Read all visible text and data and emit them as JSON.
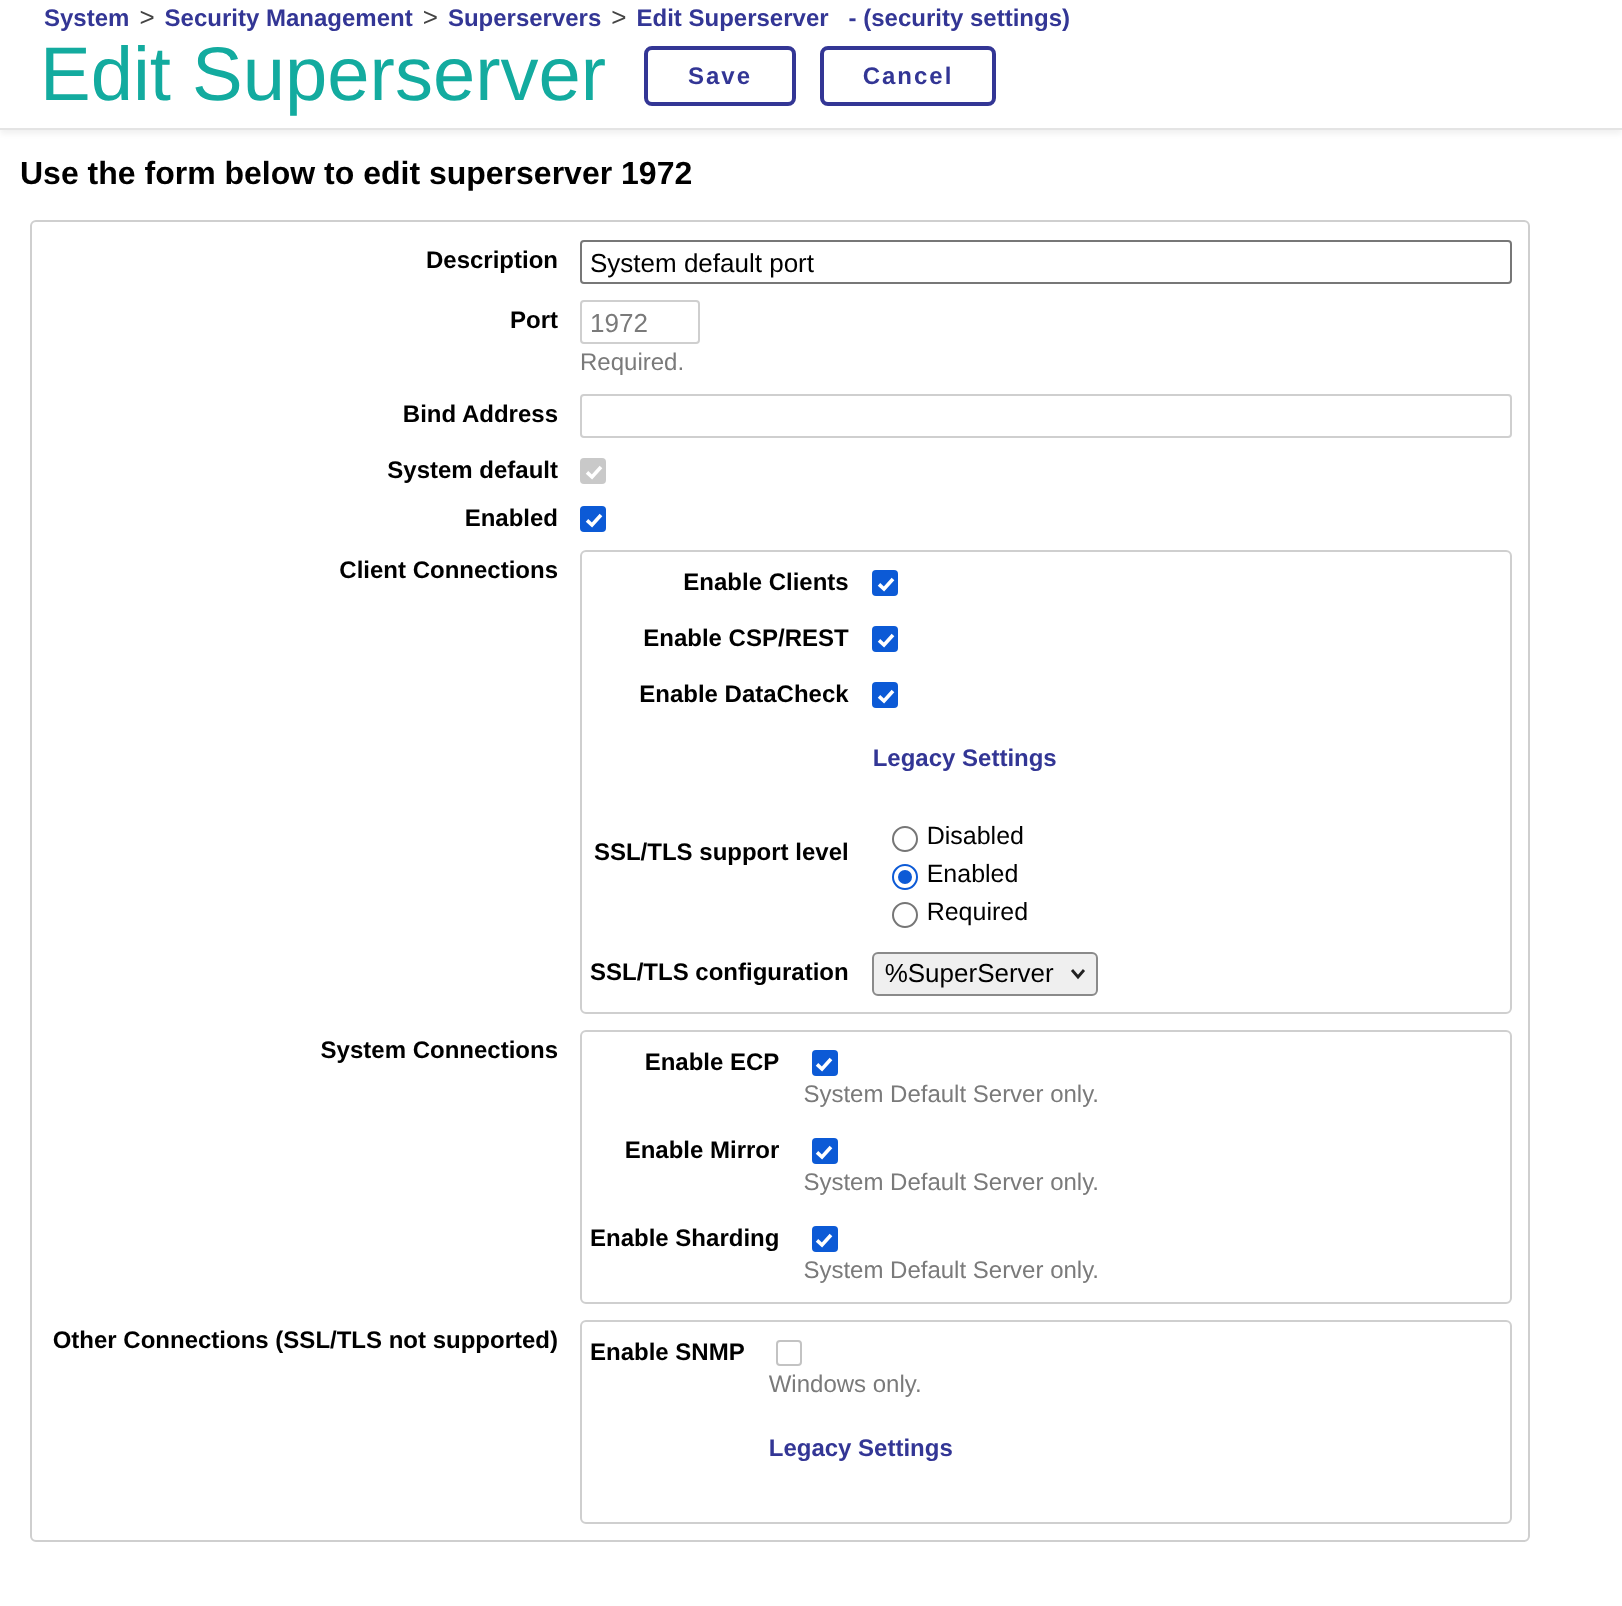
{
  "breadcrumb": {
    "items": [
      {
        "label": "System",
        "separator": ">"
      },
      {
        "label": "Security Management",
        "separator": ">"
      },
      {
        "label": "Superservers",
        "separator": ">"
      },
      {
        "label": "Edit Superserver"
      }
    ],
    "note": "- (security settings)"
  },
  "title": "Edit Superserver",
  "buttons": [
    {
      "label": "Save"
    },
    {
      "label": "Cancel"
    }
  ],
  "instructions": "Use the form below to edit superserver 1972",
  "form": {
    "fields": [
      {
        "kind": "text",
        "label": "Description",
        "value": "System default port"
      },
      {
        "kind": "short_text",
        "label": "Port",
        "value": "1972",
        "disabled": true,
        "hint": "Required."
      },
      {
        "kind": "text",
        "label": "Bind Address"
      },
      {
        "kind": "checkbox",
        "label": "System default",
        "checked": true,
        "disabled": true
      },
      {
        "kind": "checkbox",
        "label": "Enabled",
        "checked": true,
        "disabled": false
      },
      {
        "kind": "group",
        "label": "Client Connections",
        "items": [
          {
            "kind": "checkbox",
            "label": "Enable Clients",
            "checked": true,
            "disabled": false
          },
          {
            "kind": "checkbox",
            "label": "Enable CSP/REST",
            "checked": true,
            "disabled": false
          },
          {
            "kind": "checkbox",
            "label": "Enable DataCheck",
            "checked": true,
            "disabled": false
          },
          {
            "kind": "link",
            "label": "Legacy Settings"
          },
          {
            "kind": "radio",
            "label": "SSL/TLS support level",
            "options": [
              {
                "label": "Disabled",
                "selected": false
              },
              {
                "label": "Enabled",
                "selected": true
              },
              {
                "label": "Required",
                "selected": false
              }
            ]
          },
          {
            "kind": "select",
            "label": "SSL/TLS configuration",
            "value": "%SuperServer"
          }
        ]
      },
      {
        "kind": "group",
        "label": "System Connections",
        "items": [
          {
            "kind": "checkbox",
            "label": "Enable ECP",
            "checked": true,
            "disabled": false,
            "hint": "System Default Server only."
          },
          {
            "kind": "checkbox",
            "label": "Enable Mirror",
            "checked": true,
            "disabled": false,
            "hint": "System Default Server only."
          },
          {
            "kind": "checkbox",
            "label": "Enable Sharding",
            "checked": true,
            "disabled": false,
            "hint": "System Default Server only."
          }
        ]
      },
      {
        "kind": "group",
        "label": "Other Connections (SSL/TLS not supported)",
        "items": [
          {
            "kind": "checkbox",
            "label": "Enable SNMP",
            "checked": false,
            "disabled": true,
            "hint": "Windows only."
          },
          {
            "kind": "link",
            "label": "Legacy Settings"
          }
        ]
      }
    ]
  }
}
